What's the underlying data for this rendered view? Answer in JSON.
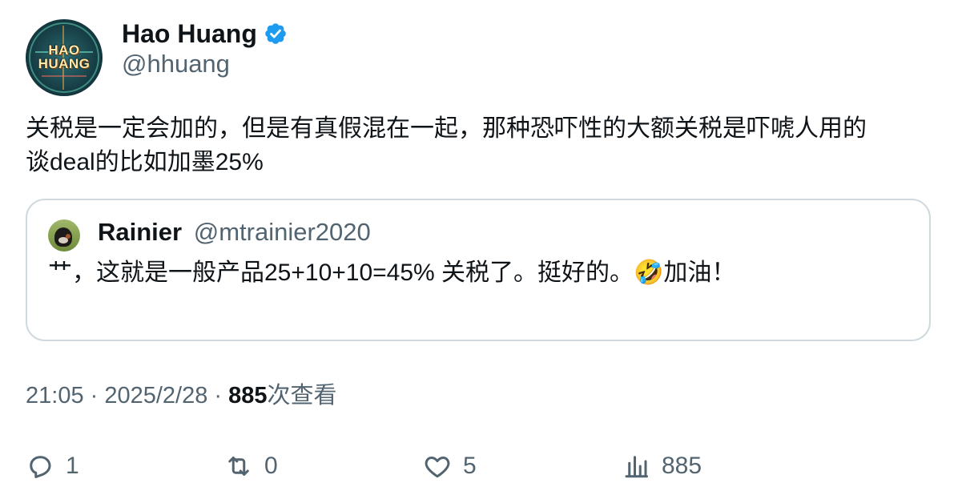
{
  "author": {
    "name": "Hao Huang",
    "handle": "@hhuang",
    "avatar_text": "HAO HUANG",
    "verified_icon": "verified-badge-icon",
    "verified_color": "#1d9bf0"
  },
  "tweet": {
    "text_line1": "关税是一定会加的，但是有真假混在一起，那种恐吓性的大额关税是吓唬人用的",
    "text_line2": "谈deal的比如加墨25%"
  },
  "quote": {
    "name": "Rainier",
    "handle": "@mtrainier2020",
    "text": "艹，这就是一般产品25+10+10=45% 关税了。挺好的。🤣加油！"
  },
  "meta": {
    "time": "21:05",
    "separator1": " · ",
    "date": "2025/2/28",
    "separator2": " · ",
    "views_count": "885",
    "views_label": "次查看"
  },
  "actions": {
    "reply_count": "1",
    "retweet_count": "0",
    "like_count": "5",
    "views_count": "885",
    "icons": [
      "reply-icon",
      "retweet-icon",
      "like-icon",
      "views-icon"
    ]
  },
  "colors": {
    "text_primary": "#0f1419",
    "text_secondary": "#536471",
    "border": "#cfd9de"
  }
}
